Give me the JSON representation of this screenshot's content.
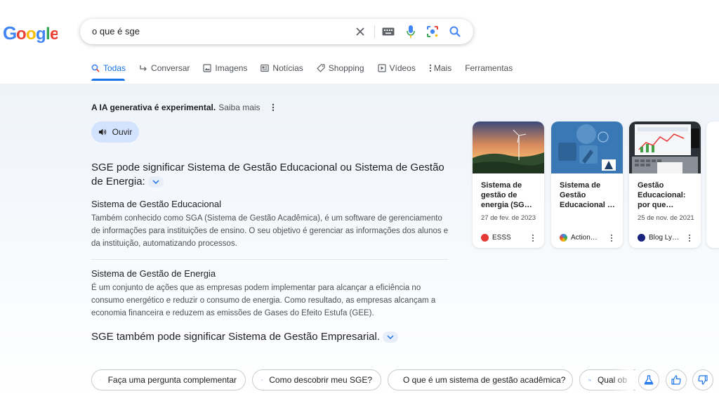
{
  "header": {
    "logo_text": "Google",
    "search_query": "o que é sge"
  },
  "tabs": [
    {
      "label": "Todas",
      "icon": "search-icon",
      "active": true
    },
    {
      "label": "Conversar",
      "icon": "converse-arrow-icon"
    },
    {
      "label": "Imagens",
      "icon": "image-icon"
    },
    {
      "label": "Notícias",
      "icon": "news-icon"
    },
    {
      "label": "Shopping",
      "icon": "tag-icon"
    },
    {
      "label": "Vídeos",
      "icon": "video-icon"
    },
    {
      "label": "Mais",
      "icon": "more-vert-icon"
    },
    {
      "label": "Ferramentas"
    }
  ],
  "ai": {
    "experimental_bold": "A IA generativa é experimental.",
    "learn_more": "Saiba mais",
    "listen_label": "Ouvir",
    "heading": "SGE pode significar Sistema de Gestão Educacional ou Sistema de Gestão de Energia:",
    "section1_title": "Sistema de Gestão Educacional",
    "section1_text": "Também conhecido como SGA (Sistema de Gestão Acadêmica), é um software de gerenciamento de informações para instituições de ensino. O seu objetivo é gerenciar as informações dos alunos e da instituição, automatizando processos.",
    "section2_title": "Sistema de Gestão de Energia",
    "section2_text": "É um conjunto de ações que as empresas podem implementar para alcançar a eficiência no consumo energético e reduzir o consumo de energia. Como resultado, as empresas alcançam a economia financeira e reduzem as emissões de Gases do Efeito Estufa (GEE).",
    "bottom_heading": "SGE também pode significar Sistema de Gestão Empresarial."
  },
  "cards": [
    {
      "title": "Sistema de gestão de energia (SG…",
      "date": "27 de fev. de 2023",
      "source": "ESSS",
      "favicon_color": "#e53935"
    },
    {
      "title": "Sistema de Gestão Educacional …",
      "date": "",
      "source": "Action…",
      "favicon_color": "#9e9e9e"
    },
    {
      "title": "Gestão Educacional: por que…",
      "date": "25 de nov. de 2021",
      "source": "Blog Ly…",
      "favicon_color": "#1a237e"
    }
  ],
  "chips": [
    {
      "label": "Faça uma pergunta complementar"
    },
    {
      "label": "Como descobrir meu SGE?"
    },
    {
      "label": "O que é um sistema de gestão acadêmica?"
    },
    {
      "label": "Qual ob"
    }
  ],
  "colors": {
    "accent": "#1a73e8",
    "ouvir_bg": "#d3e3fd"
  }
}
